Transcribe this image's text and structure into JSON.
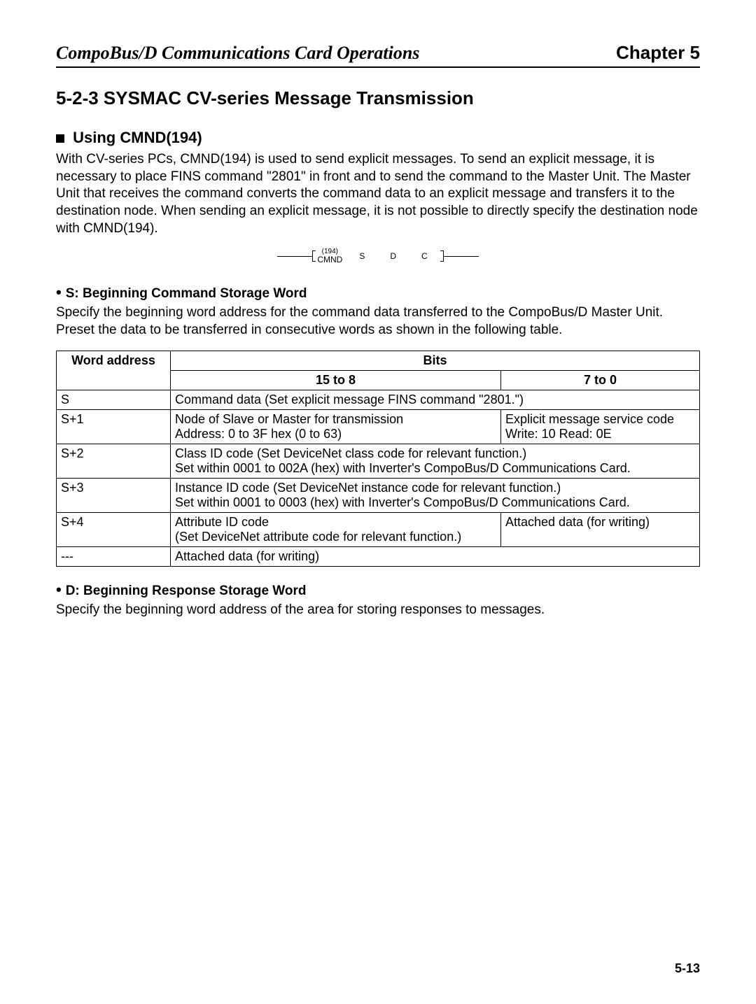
{
  "header": {
    "left": "CompoBus/D Communications Card Operations",
    "right": "Chapter 5"
  },
  "section": {
    "number_title": "5-2-3  SYSMAC CV-series Message Transmission"
  },
  "using_cmnd": {
    "title": "Using CMND(194)",
    "body": "With CV-series PCs, CMND(194) is used to send explicit messages. To send an explicit message, it is necessary to place FINS command \"2801\" in front and to send the command to the Master Unit. The Master Unit that receives the command converts the command data to an explicit message and transfers it to the destination node. When sending an explicit message, it is not possible to directly specify the destination node with CMND(194)."
  },
  "ladder": {
    "sup": "(194)",
    "cmnd": "CMND",
    "s": "S",
    "d": "D",
    "c": "C"
  },
  "s_section": {
    "title": "S: Beginning Command Storage Word",
    "body": "Specify the beginning word address for the command data transferred to the CompoBus/D Master Unit. Preset the data to be transferred in consecutive words as shown in the following table."
  },
  "table": {
    "headers": {
      "word_address": "Word address",
      "bits": "Bits",
      "b15_8": "15 to 8",
      "b7_0": "7 to 0"
    },
    "rows": {
      "r0": {
        "addr": "S",
        "full": "Command data (Set explicit message FINS command \"2801.\")"
      },
      "r1": {
        "addr": "S+1",
        "left": "Node of Slave or Master for transmission\nAddress: 0 to 3F hex (0 to 63)",
        "right": "Explicit message service code\nWrite: 10            Read: 0E"
      },
      "r2": {
        "addr": "S+2",
        "full": "Class ID code (Set DeviceNet class code for relevant function.)\nSet within 0001 to 002A (hex) with Inverter's CompoBus/D Communications Card."
      },
      "r3": {
        "addr": "S+3",
        "full": "Instance ID code (Set DeviceNet instance code for relevant function.)\nSet within 0001 to 0003 (hex) with Inverter's CompoBus/D Communications Card."
      },
      "r4": {
        "addr": "S+4",
        "left": "Attribute ID code\n(Set DeviceNet attribute code for relevant function.)",
        "right": "Attached data (for writing)"
      },
      "r5": {
        "addr": "---",
        "full": "Attached data (for writing)"
      }
    }
  },
  "d_section": {
    "title": "D: Beginning Response Storage Word",
    "body": "Specify the beginning word address of the area for storing responses to messages."
  },
  "page_number": "5-13"
}
